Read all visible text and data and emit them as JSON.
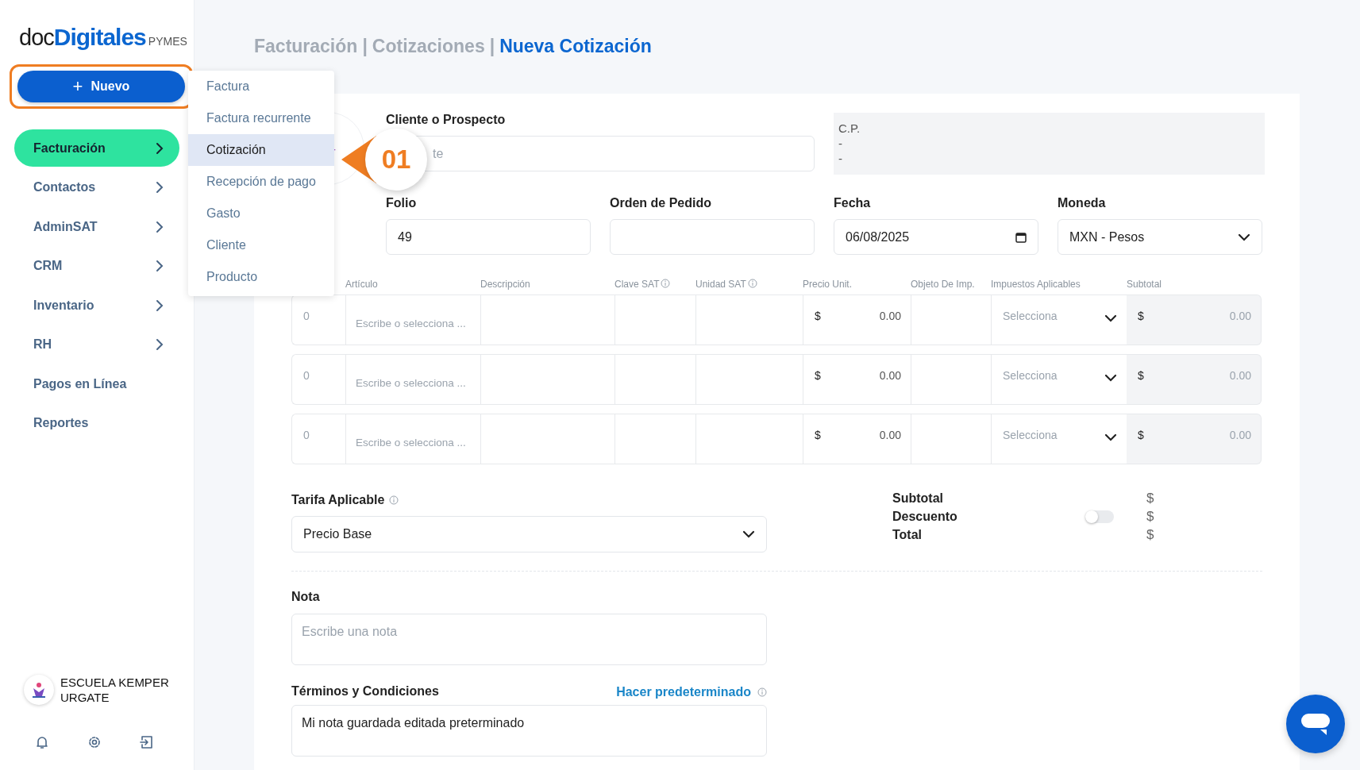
{
  "brand": {
    "name_light": "doc",
    "name_bold": "Digitales",
    "suffix": "PYMES"
  },
  "new_button": {
    "label": "Nuevo",
    "icon": "+",
    "highlighted": true
  },
  "nav": [
    {
      "label": "Facturación",
      "selected": true,
      "expandable": true
    },
    {
      "label": "Contactos",
      "selected": false,
      "expandable": true
    },
    {
      "label": "AdminSAT",
      "selected": false,
      "expandable": true
    },
    {
      "label": "CRM",
      "selected": false,
      "expandable": true
    },
    {
      "label": "Inventario",
      "selected": false,
      "expandable": true
    },
    {
      "label": "RH",
      "selected": false,
      "expandable": true
    },
    {
      "label": "Pagos en Línea",
      "selected": false,
      "expandable": false
    },
    {
      "label": "Reportes",
      "selected": false,
      "expandable": false
    }
  ],
  "user": {
    "name": "ESCUELA KEMPER URGATE"
  },
  "new_menu": {
    "items": [
      {
        "label": "Factura",
        "selected": false
      },
      {
        "label": "Factura recurrente",
        "selected": false
      },
      {
        "label": "Cotización",
        "selected": true
      },
      {
        "label": "Recepción de pago",
        "selected": false
      },
      {
        "label": "Gasto",
        "selected": false
      },
      {
        "label": "Cliente",
        "selected": false
      },
      {
        "label": "Producto",
        "selected": false
      }
    ]
  },
  "callout": {
    "label": "01"
  },
  "breadcrumb": {
    "separator": "|",
    "items": [
      {
        "label": "Facturación",
        "current": false
      },
      {
        "label": "Cotizaciones",
        "current": false
      },
      {
        "label": "Nueva Cotización",
        "current": true
      }
    ]
  },
  "client": {
    "label": "Cliente o Prospecto",
    "placeholder": "te"
  },
  "postal": {
    "label": "C.P.",
    "lines": [
      "-",
      "-"
    ]
  },
  "fields": [
    {
      "label": "Folio",
      "kind": "text",
      "value": "49"
    },
    {
      "label": "Orden de Pedido",
      "kind": "text"
    },
    {
      "label": "Fecha",
      "kind": "date",
      "value": "06/08/2025"
    },
    {
      "label": "Moneda",
      "kind": "select",
      "value": "MXN - Pesos"
    }
  ],
  "items_table": {
    "columns": [
      {
        "label": "Artículo",
        "info": false
      },
      {
        "label": "Descripción",
        "info": false
      },
      {
        "label": "Clave SAT",
        "info": true
      },
      {
        "label": "Unidad SAT",
        "info": true
      },
      {
        "label": "Precio Unit.",
        "info": false
      },
      {
        "label": "Objeto De Imp.",
        "info": false
      },
      {
        "label": "Impuestos Aplicables",
        "info": false
      },
      {
        "label": "Subtotal",
        "info": false
      }
    ],
    "rows": [
      {
        "quantity": "0",
        "article_placeholder": "Escribe o selecciona ...",
        "currency": "$",
        "unit_price": "0.00",
        "taxes_placeholder": "Selecciona",
        "subtotal_currency": "$",
        "subtotal": "0.00"
      },
      {
        "quantity": "0",
        "article_placeholder": "Escribe o selecciona ...",
        "currency": "$",
        "unit_price": "0.00",
        "taxes_placeholder": "Selecciona",
        "subtotal_currency": "$",
        "subtotal": "0.00"
      },
      {
        "quantity": "0",
        "article_placeholder": "Escribe o selecciona ...",
        "currency": "$",
        "unit_price": "0.00",
        "taxes_placeholder": "Selecciona",
        "subtotal_currency": "$",
        "subtotal": "0.00"
      }
    ]
  },
  "tarifa": {
    "label": "Tarifa Aplicable",
    "value": "Precio Base"
  },
  "totals": [
    {
      "label": "Subtotal",
      "currency": "$",
      "kind": "plain"
    },
    {
      "label": "Descuento",
      "currency": "$",
      "kind": "toggle",
      "on": false
    },
    {
      "label": "Total",
      "currency": "$",
      "kind": "plain"
    }
  ],
  "note": {
    "label": "Nota",
    "placeholder": "Escribe una nota"
  },
  "terms": {
    "label": "Términos y Condiciones",
    "link": "Hacer predeterminado",
    "value": "Mi nota guardada editada preterminado"
  }
}
